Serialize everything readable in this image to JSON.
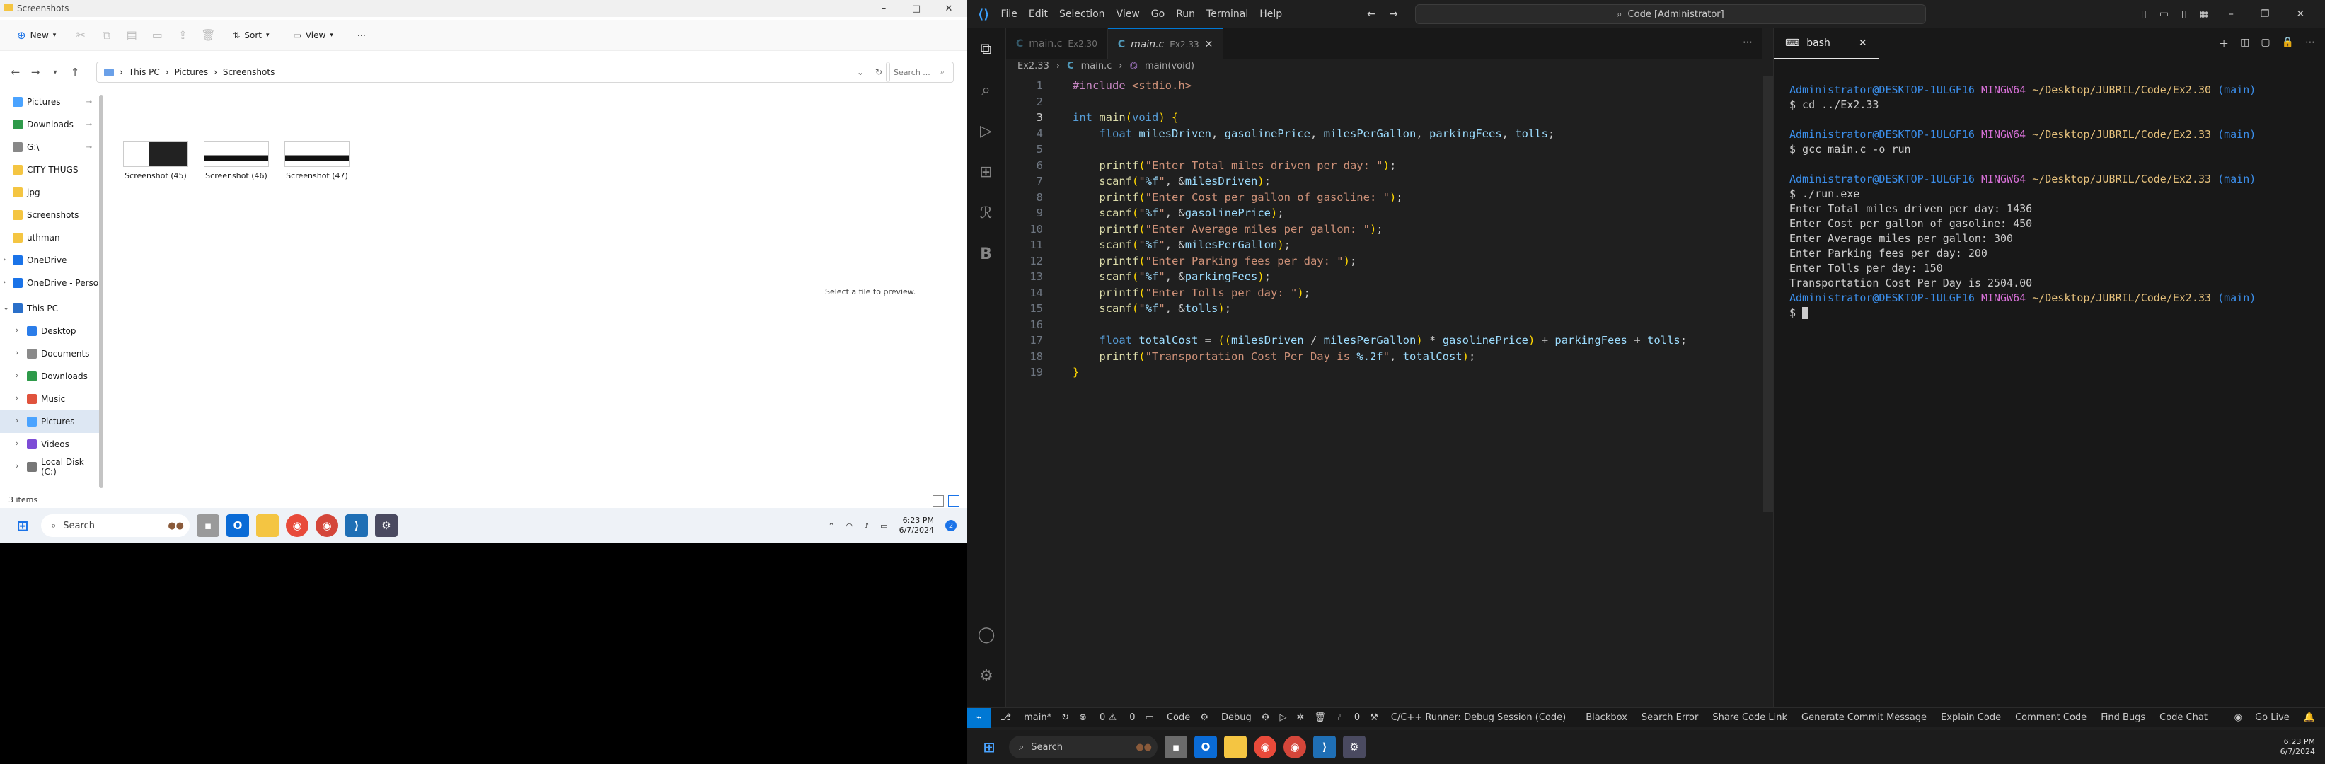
{
  "explorer": {
    "title": "Screenshots",
    "toolbar": {
      "new": "New",
      "sort": "Sort",
      "view": "View",
      "more": "⋯"
    },
    "breadcrumb": [
      "This PC",
      "Pictures",
      "Screenshots"
    ],
    "search_placeholder": "Search ...",
    "nav": [
      {
        "label": "Pictures",
        "pinned": true,
        "color": "#4aa3ff"
      },
      {
        "label": "Downloads",
        "pinned": true,
        "color": "#2e9a4a"
      },
      {
        "label": "G:\\",
        "pinned": true,
        "color": "#888888"
      },
      {
        "label": "CITY THUGS",
        "pinned": false,
        "color": "#f4c542"
      },
      {
        "label": "jpg",
        "pinned": false,
        "color": "#f4c542"
      },
      {
        "label": "Screenshots",
        "pinned": false,
        "color": "#f4c542"
      },
      {
        "label": "uthman",
        "pinned": false,
        "color": "#f4c542"
      }
    ],
    "nav_roots": [
      {
        "label": "OneDrive",
        "color": "#1a73e8"
      },
      {
        "label": "OneDrive - Perso",
        "color": "#1a73e8"
      },
      {
        "label": "This PC",
        "color": "#2a6fc9"
      }
    ],
    "nav_pc": [
      {
        "label": "Desktop",
        "color": "#2b7de9",
        "selected": false
      },
      {
        "label": "Documents",
        "color": "#8a8a8a",
        "selected": false
      },
      {
        "label": "Downloads",
        "color": "#2e9a4a",
        "selected": false
      },
      {
        "label": "Music",
        "color": "#e0533d",
        "selected": false
      },
      {
        "label": "Pictures",
        "color": "#4aa3ff",
        "selected": true
      },
      {
        "label": "Videos",
        "color": "#7d4cd6",
        "selected": false
      },
      {
        "label": "Local Disk (C:)",
        "color": "#777777",
        "selected": false
      }
    ],
    "files": [
      "Screenshot (45)",
      "Screenshot (46)",
      "Screenshot (47)"
    ],
    "preview": "Select a file to preview.",
    "status": "3 items"
  },
  "taskbar_left": {
    "search": "Search",
    "time": "6:23 PM",
    "date": "6/7/2024",
    "notifications": "2"
  },
  "vscode": {
    "menu": [
      "File",
      "Edit",
      "Selection",
      "View",
      "Go",
      "Run",
      "Terminal",
      "Help"
    ],
    "command_center": "Code [Administrator]",
    "tabs": [
      {
        "label": "main.c",
        "path": "Ex2.30",
        "dim": true
      },
      {
        "label": "main.c",
        "path": "Ex2.33",
        "dim": false
      }
    ],
    "breadcrumb": [
      "Ex2.33",
      "main.c",
      "main(void)"
    ],
    "line_numbers": [
      "1",
      "2",
      "3",
      "4",
      "5",
      "6",
      "7",
      "8",
      "9",
      "10",
      "11",
      "12",
      "13",
      "14",
      "15",
      "16",
      "17",
      "18",
      "19"
    ],
    "current_line": "3",
    "code_lines": [
      "#include <stdio.h>",
      "",
      "int main(void) {",
      "    float milesDriven, gasolinePrice, milesPerGallon, parkingFees, tolls;",
      "",
      "    printf(\"Enter Total miles driven per day: \");",
      "    scanf(\"%f\", &milesDriven);",
      "    printf(\"Enter Cost per gallon of gasoline: \");",
      "    scanf(\"%f\", &gasolinePrice);",
      "    printf(\"Enter Average miles per gallon: \");",
      "    scanf(\"%f\", &milesPerGallon);",
      "    printf(\"Enter Parking fees per day: \");",
      "    scanf(\"%f\", &parkingFees);",
      "    printf(\"Enter Tolls per day: \");",
      "    scanf(\"%f\", &tolls);",
      "",
      "    float totalCost = ((milesDriven / milesPerGallon) * gasolinePrice) + parkingFees + tolls;",
      "    printf(\"Transportation Cost Per Day is %.2f\", totalCost);",
      "}"
    ],
    "terminal": {
      "tab": "bash",
      "prompt_user": "Administrator@DESKTOP-1ULGF16",
      "prompt_env": "MINGW64",
      "paths": [
        "~/Desktop/JUBRIL/Code/Ex2.30",
        "~/Desktop/JUBRIL/Code/Ex2.33",
        "~/Desktop/JUBRIL/Code/Ex2.33",
        "~/Desktop/JUBRIL/Code/Ex2.33"
      ],
      "branch": "(main)",
      "commands": [
        "$ cd ../Ex2.33",
        "$ gcc main.c -o run",
        "$ ./run.exe"
      ],
      "output": [
        "Enter Total miles driven per day: 1436",
        "Enter Cost per gallon of gasoline: 450",
        "Enter Average miles per gallon: 300",
        "Enter Parking fees per day: 200",
        "Enter Tolls per day: 150",
        "Transportation Cost Per Day is 2504.00"
      ],
      "last_prompt": "$ "
    },
    "status": {
      "branch": "main*",
      "errors": "0",
      "warnings": "0",
      "code": "Code",
      "debug": "Debug",
      "ports": "0",
      "runner": "C/C++ Runner: Debug Session (Code)",
      "items": [
        "Blackbox",
        "Search Error",
        "Share Code Link",
        "Generate Commit Message",
        "Explain Code",
        "Comment Code",
        "Find Bugs",
        "Code Chat"
      ],
      "golive": "Go Live"
    }
  },
  "taskbar_right": {
    "search": "Search",
    "time": "6:23 PM",
    "date": "6/7/2024"
  }
}
